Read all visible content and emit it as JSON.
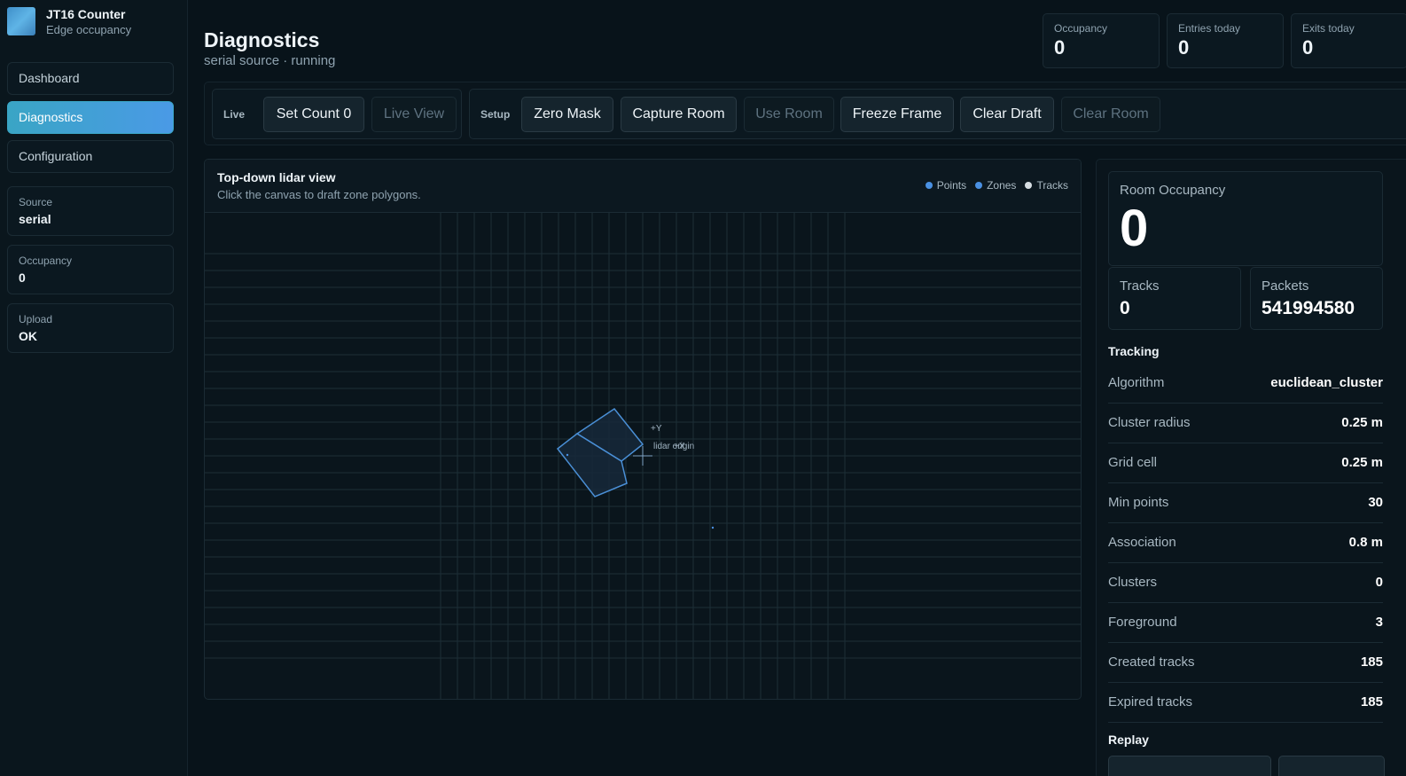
{
  "brand": {
    "title": "JT16 Counter",
    "subtitle": "Edge occupancy"
  },
  "nav": {
    "items": [
      {
        "label": "Dashboard"
      },
      {
        "label": "Diagnostics",
        "active": true
      },
      {
        "label": "Configuration"
      }
    ]
  },
  "sidebar_info": [
    {
      "label": "Source",
      "value": "serial"
    },
    {
      "label": "Occupancy",
      "value": "0"
    },
    {
      "label": "Upload",
      "value": "OK"
    }
  ],
  "header": {
    "title": "Diagnostics",
    "subtitle": "serial source · running"
  },
  "stats": [
    {
      "label": "Occupancy",
      "value": "0"
    },
    {
      "label": "Entries today",
      "value": "0"
    },
    {
      "label": "Exits today",
      "value": "0"
    }
  ],
  "toolbar": {
    "live": {
      "label": "Live",
      "buttons": [
        {
          "label": "Set Count 0",
          "disabled": false
        },
        {
          "label": "Live View",
          "disabled": true
        }
      ]
    },
    "setup": {
      "label": "Setup",
      "buttons": [
        {
          "label": "Zero Mask",
          "disabled": false
        },
        {
          "label": "Capture Room",
          "disabled": false
        },
        {
          "label": "Use Room",
          "disabled": true
        },
        {
          "label": "Freeze Frame",
          "disabled": false
        },
        {
          "label": "Clear Draft",
          "disabled": false
        },
        {
          "label": "Clear Room",
          "disabled": true
        }
      ]
    }
  },
  "lidar": {
    "title": "Top-down lidar view",
    "subtitle": "Click the canvas to draft zone polygons.",
    "legend": [
      {
        "label": "Points",
        "color": "#4a90e2"
      },
      {
        "label": "Zones",
        "color": "#4a90e2"
      },
      {
        "label": "Tracks",
        "color": "#d6dde2"
      }
    ],
    "axis_labels": {
      "y": "+Y",
      "origin": "lidar origin",
      "x": "+X"
    },
    "colors": {
      "grid": "#1d2e36",
      "zone_stroke": "#4a8fd6",
      "zone_fill": "#16283a"
    }
  },
  "right_panel": {
    "room_occupancy": {
      "label": "Room Occupancy",
      "value": "0"
    },
    "tracks": {
      "label": "Tracks",
      "value": "0"
    },
    "packets": {
      "label": "Packets",
      "value": "541994580"
    },
    "tracking_title": "Tracking",
    "tracking": [
      {
        "key": "Algorithm",
        "value": "euclidean_cluster"
      },
      {
        "key": "Cluster radius",
        "value": "0.25 m"
      },
      {
        "key": "Grid cell",
        "value": "0.25 m"
      },
      {
        "key": "Min points",
        "value": "30"
      },
      {
        "key": "Association",
        "value": "0.8 m"
      },
      {
        "key": "Clusters",
        "value": "0"
      },
      {
        "key": "Foreground",
        "value": "3"
      },
      {
        "key": "Created tracks",
        "value": "185"
      },
      {
        "key": "Expired tracks",
        "value": "185"
      }
    ],
    "replay_title": "Replay"
  }
}
